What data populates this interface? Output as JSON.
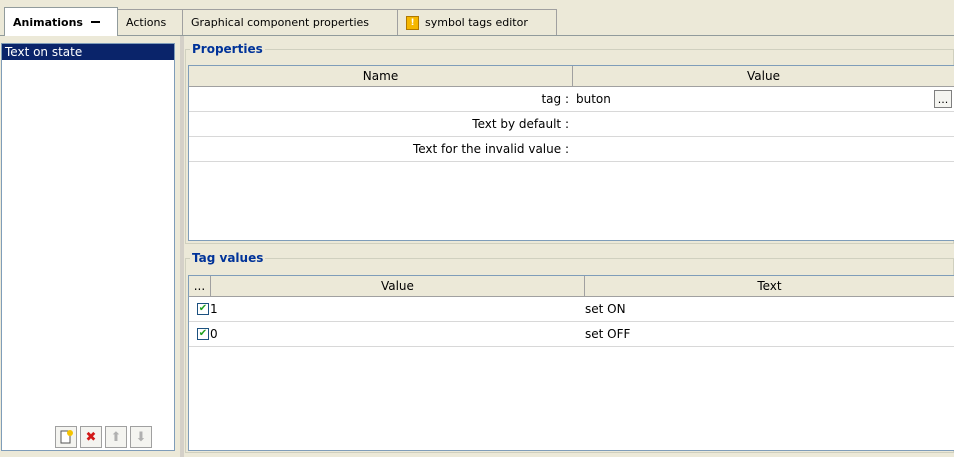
{
  "tabs": [
    {
      "label": "Animations",
      "active": true
    },
    {
      "label": "Actions"
    },
    {
      "label": "Graphical component properties"
    },
    {
      "label": "symbol tags editor"
    }
  ],
  "animations": {
    "items": [
      "Text on state"
    ],
    "toolbar": {
      "new_icon": "new-icon",
      "delete_icon": "delete-icon",
      "up_icon": "arrow-up-icon",
      "down_icon": "arrow-down-icon"
    }
  },
  "properties": {
    "title": "Properties",
    "columns": [
      "Name",
      "Value"
    ],
    "rows": [
      {
        "name": "tag :",
        "value": "buton",
        "has_button": true,
        "button_label": "..."
      },
      {
        "name": "Text by default :",
        "value": ""
      },
      {
        "name": "Text for the invalid value :",
        "value": ""
      }
    ]
  },
  "tag_values": {
    "title": "Tag values",
    "columns": [
      "...",
      "Value",
      "Text"
    ],
    "rows": [
      {
        "checked": true,
        "value": "1",
        "text": "set ON"
      },
      {
        "checked": true,
        "value": "0",
        "text": "set OFF"
      }
    ]
  },
  "colors": {
    "selection": "#0a246a",
    "group_title": "#003399",
    "checkmark": "#21a121",
    "delete": "#d21818"
  }
}
